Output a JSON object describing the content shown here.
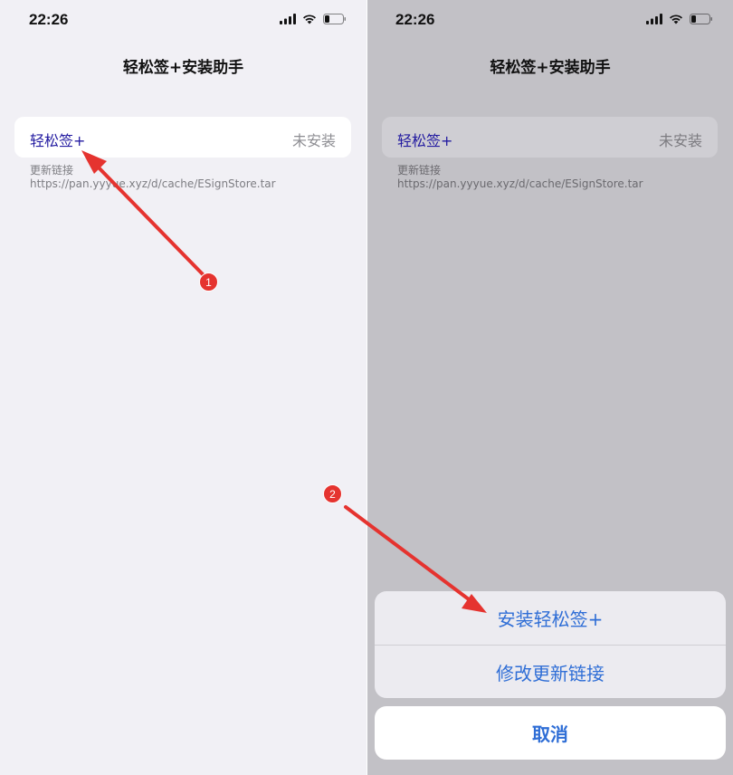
{
  "left_screen": {
    "status_bar": {
      "time": "22:26"
    },
    "nav_title": "轻松签+安装助手",
    "cell": {
      "label": "轻松签+",
      "value": "未安装"
    },
    "footer": {
      "caption": "更新链接",
      "url": "https://pan.yyyue.xyz/d/cache/ESignStore.tar"
    }
  },
  "right_screen": {
    "status_bar": {
      "time": "22:26"
    },
    "nav_title": "轻松签+安装助手",
    "cell": {
      "label": "轻松签+",
      "value": "未安装"
    },
    "footer": {
      "caption": "更新链接",
      "url": "https://pan.yyyue.xyz/d/cache/ESignStore.tar"
    },
    "action_sheet": {
      "actions": [
        "安装轻松签+",
        "修改更新链接"
      ],
      "cancel": "取消"
    }
  },
  "annotations": {
    "step1": "1",
    "step2": "2"
  },
  "colors": {
    "accent": "#2f6ed6",
    "cell_label": "#221aa0",
    "arrow": "#e5332f",
    "dim_overlay": "#c2c1c6"
  },
  "icons": [
    "signal-icon",
    "wifi-icon",
    "battery-icon",
    "arrow-annotation"
  ]
}
